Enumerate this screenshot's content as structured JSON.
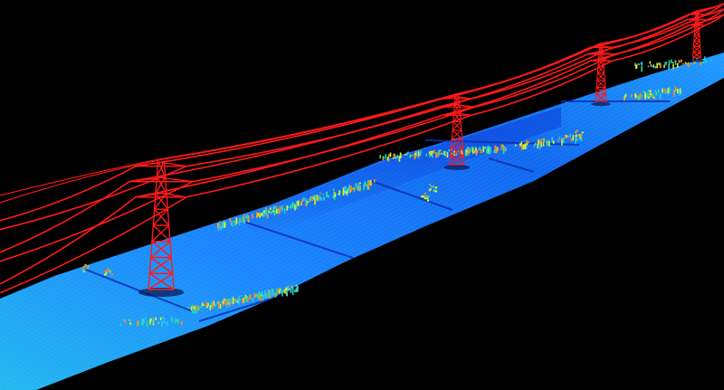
{
  "scene": {
    "description_visible_text": "",
    "colors": {
      "background": "#000000",
      "ground_low": "#0a3fd6",
      "ground_mid": "#1f8cff",
      "ground_high": "#23c7f0",
      "vegetation_low": "#2fe08a",
      "vegetation_mid": "#d8f02a",
      "vegetation_high": "#ff8a1a",
      "towers_and_wires": "#ff1a1a"
    },
    "towers": [
      {
        "name": "tower-1"
      },
      {
        "name": "tower-2"
      },
      {
        "name": "tower-3"
      },
      {
        "name": "tower-4"
      }
    ]
  }
}
